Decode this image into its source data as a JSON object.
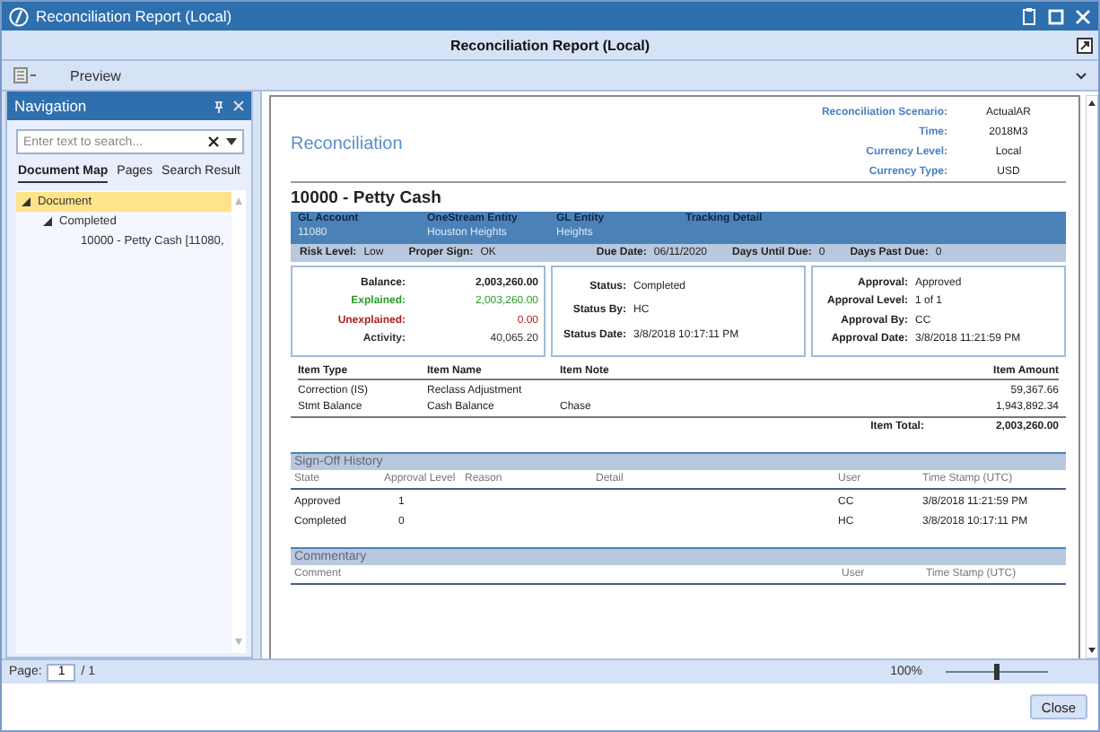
{
  "window": {
    "title": "Reconciliation Report (Local)"
  },
  "header": {
    "title": "Reconciliation Report (Local)"
  },
  "toolbar": {
    "label": "Preview"
  },
  "navigation": {
    "title": "Navigation",
    "search": {
      "placeholder": "Enter text to search..."
    },
    "tabs": [
      {
        "label": "Document Map",
        "selected": true
      },
      {
        "label": "Pages",
        "selected": false
      },
      {
        "label": "Search Result",
        "selected": false
      }
    ],
    "tree": [
      {
        "label": "Document",
        "selected": true,
        "expanded": true,
        "children": [
          {
            "label": "Completed",
            "selected": false,
            "expanded": true,
            "children": [
              {
                "label": "10000 - Petty Cash  [11080,",
                "selected": false
              }
            ]
          }
        ]
      }
    ]
  },
  "report": {
    "title": "Reconciliation",
    "meta": [
      {
        "label": "Reconciliation Scenario:",
        "value": "ActualAR"
      },
      {
        "label": "Time:",
        "value": "2018M3"
      },
      {
        "label": "Currency Level:",
        "value": "Local"
      },
      {
        "label": "Currency Type:",
        "value": "USD"
      }
    ],
    "account_title": "10000 - Petty Cash",
    "info_band": [
      {
        "label": "GL Account",
        "value": "11080"
      },
      {
        "label": "OneStream Entity",
        "value": "Houston Heights"
      },
      {
        "label": "GL Entity",
        "value": "Heights"
      },
      {
        "label": "Tracking Detail"
      }
    ],
    "risk_band": [
      {
        "label": "Risk Level:",
        "value": "Low"
      },
      {
        "label": "Proper Sign:",
        "value": "OK"
      },
      {
        "label": "Due Date:",
        "value": "06/11/2020"
      },
      {
        "label": "Days Until Due:",
        "value": "0"
      },
      {
        "label": "Days Past Due:",
        "value": "0"
      }
    ],
    "summary": [
      {
        "label": "Balance:",
        "value": "2,003,260.00",
        "kind": "total"
      },
      {
        "label": "Explained:",
        "value": "2,003,260.00",
        "kind": "good"
      },
      {
        "label": "Unexplained:",
        "value": "0.00",
        "kind": "bad"
      },
      {
        "label": "Activity:",
        "value": "40,065.20",
        "kind": "plain"
      }
    ],
    "status_box": [
      {
        "label": "Status:",
        "value": "Completed"
      },
      {
        "label": "Status By:",
        "value": "HC"
      },
      {
        "label": "Status Date:",
        "value": "3/8/2018 10:17:11 PM"
      }
    ],
    "approval_box": [
      {
        "label": "Approval:",
        "value": "Approved"
      },
      {
        "label": "Approval Level:",
        "value": "1 of 1"
      },
      {
        "label": "Approval By:",
        "value": "CC"
      },
      {
        "label": "Approval Date:",
        "value": "3/8/2018 11:21:59 PM"
      }
    ],
    "items": {
      "columns": [
        "Item Type",
        "Item Name",
        "Item Note",
        "Item Amount"
      ],
      "rows": [
        [
          "Correction (IS)",
          "Reclass Adjustment",
          "",
          "59,367.66"
        ],
        [
          "Stmt Balance",
          "Cash Balance",
          "Chase",
          "1,943,892.34"
        ]
      ],
      "total_label": "Item Total:",
      "total_value": "2,003,260.00"
    },
    "signoff": {
      "title": "Sign-Off History",
      "columns": [
        "State",
        "Approval Level",
        "Reason",
        "Detail",
        "User",
        "Time Stamp (UTC)"
      ],
      "rows": [
        [
          "Approved",
          "1",
          "",
          "",
          "CC",
          "3/8/2018 11:21:59 PM"
        ],
        [
          "Completed",
          "0",
          "",
          "",
          "HC",
          "3/8/2018 10:17:11 PM"
        ]
      ]
    },
    "commentary": {
      "title": "Commentary",
      "columns": [
        "Comment",
        "User",
        "Time Stamp (UTC)"
      ]
    }
  },
  "status_bar": {
    "page_label": "Page:",
    "page": "1",
    "page_total": "/ 1",
    "zoom": "100%",
    "zoom_slider": {
      "level": 0.5
    }
  },
  "buttons": [
    "Close"
  ]
}
